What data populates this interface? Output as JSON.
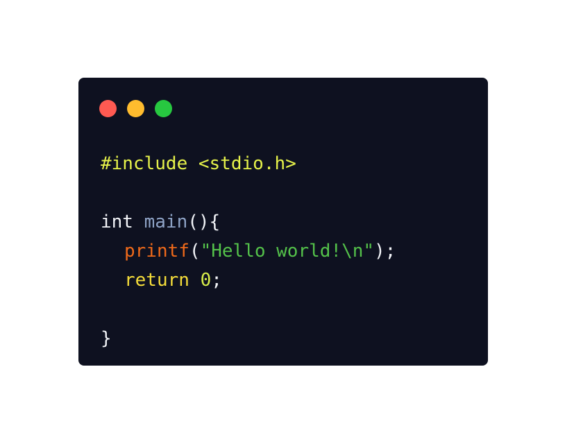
{
  "colors": {
    "page_bg": "#ffffff",
    "window_bg": "#0e1120",
    "close": "#ff5a52",
    "minimize": "#ffbc2e",
    "maximize": "#27c840",
    "text_default": "#f2f4f8",
    "preprocessor": "#e6f24a",
    "function_name": "#8ea3c6",
    "builtin_call": "#f06a1a",
    "string": "#54c24a",
    "keyword": "#f5dd3a",
    "number": "#d9ef4a"
  },
  "window_controls": [
    {
      "name": "close",
      "icon": "close-dot-icon"
    },
    {
      "name": "minimize",
      "icon": "minimize-dot-icon"
    },
    {
      "name": "maximize",
      "icon": "maximize-dot-icon"
    }
  ],
  "code": {
    "line1": {
      "include_directive": "#include <stdio.h>"
    },
    "line2": {
      "type_keyword": "int",
      "space": " ",
      "function_name": "main",
      "signature": "(){"
    },
    "line3": {
      "function_call": "printf",
      "open_paren": "(",
      "string_literal": "\"Hello world!\\n\"",
      "close": ");"
    },
    "line4": {
      "return_keyword": "return",
      "space": " ",
      "return_value": "0",
      "semicolon": ";"
    },
    "line5": {
      "closing_brace": "}"
    }
  }
}
